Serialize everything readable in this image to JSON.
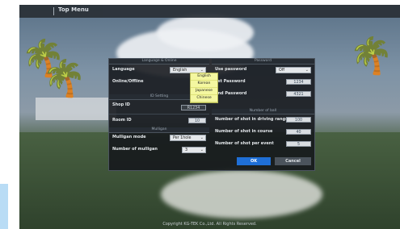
{
  "app": {
    "title": "Top Menu",
    "footer": "Copyright KG-TEK Co.,Ltd. All Rights Reserved."
  },
  "sections": {
    "language_online": "Language & Online",
    "id_setting": "ID Setting",
    "mulligan": "Mulligan",
    "password": "Password",
    "number_of_ball": "Number of ball"
  },
  "language": {
    "label": "Language",
    "value": "English",
    "options": [
      "English",
      "Korean",
      "Japanese",
      "Chinese"
    ]
  },
  "online": {
    "label": "Online/Offline"
  },
  "shop_id": {
    "label": "Shop ID",
    "value": "R1234"
  },
  "room_id": {
    "label": "Room ID",
    "value": "10"
  },
  "mulligan": {
    "mode_label": "Mulligan mode",
    "mode_value": "Per 1hole",
    "count_label": "Number of mulligan",
    "count_value": "3"
  },
  "password": {
    "use_label": "Use password",
    "use_value": "Off",
    "first_label": "1st Password",
    "first_value": "1234",
    "second_label": "2nd Password",
    "second_value": "4321"
  },
  "balls": {
    "driving_label": "Number of shot in driving range",
    "driving_value": "100",
    "course_label": "Number of shot in course",
    "course_value": "40",
    "event_label": "Number of shot per event",
    "event_value": "5"
  },
  "buttons": {
    "ok": "OK",
    "cancel": "Cancel"
  }
}
